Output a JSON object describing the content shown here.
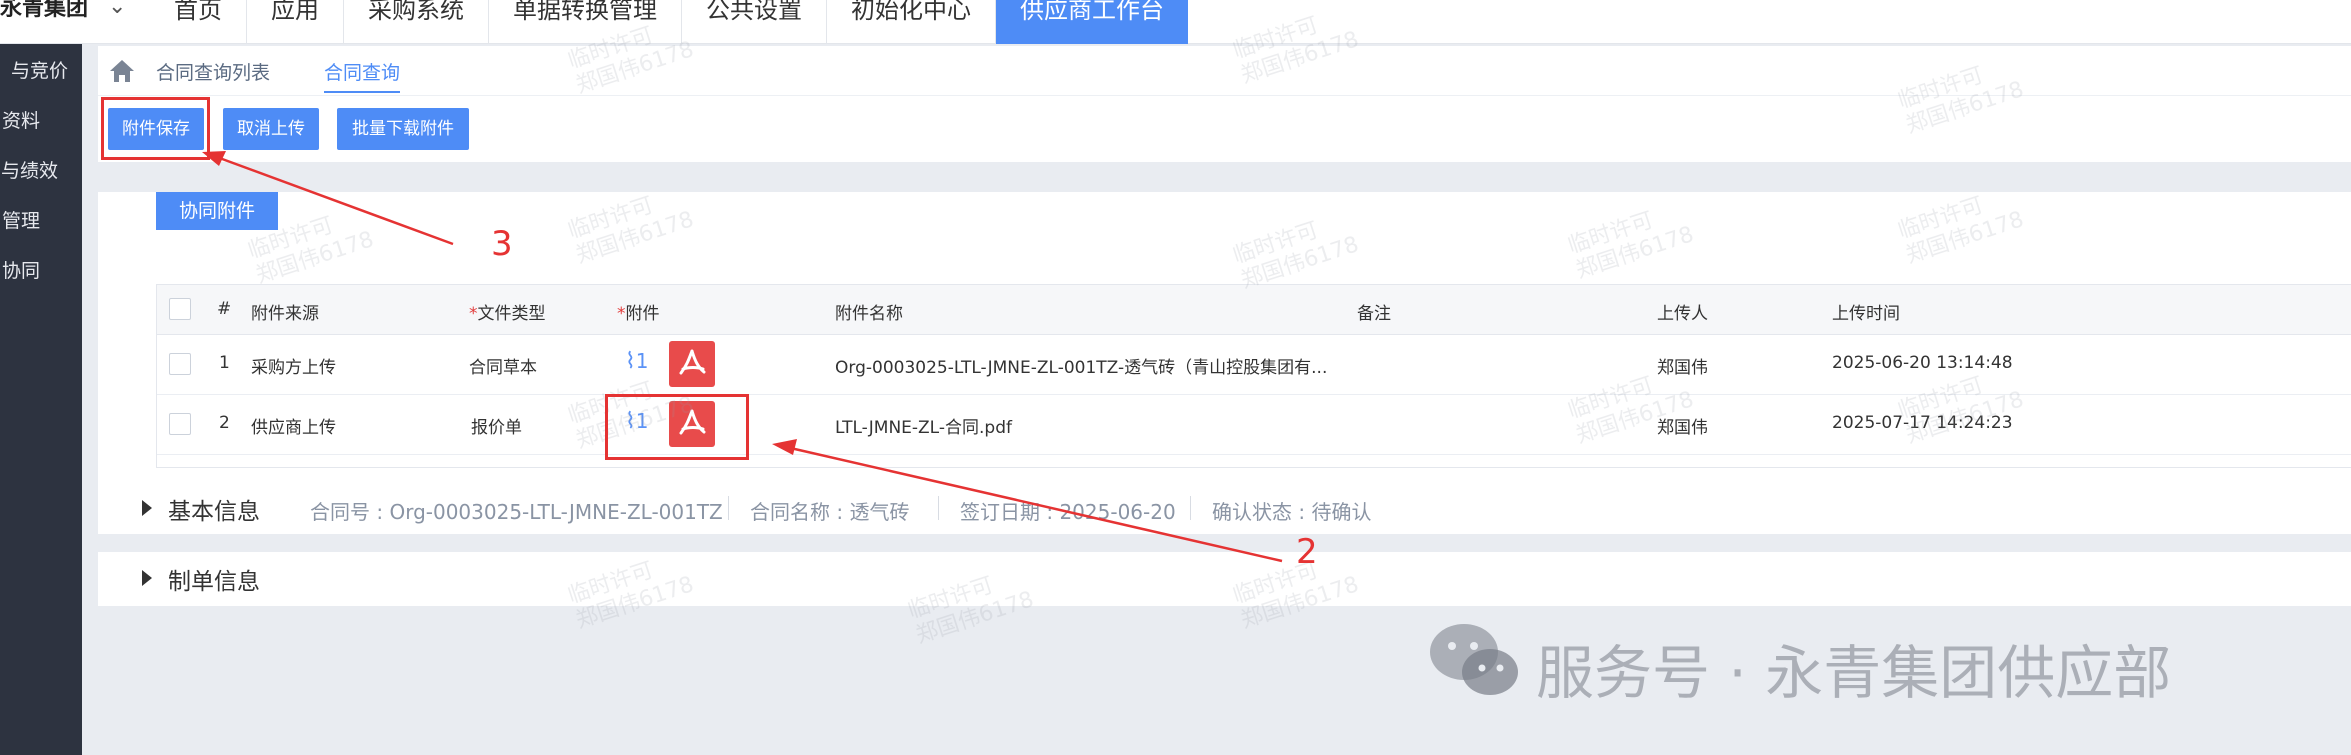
{
  "app": {
    "logo_text": "永青集团"
  },
  "nav": {
    "items": [
      {
        "label": "首页"
      },
      {
        "label": "应用"
      },
      {
        "label": "采购系统"
      },
      {
        "label": "单据转换管理"
      },
      {
        "label": "公共设置"
      },
      {
        "label": "初始化中心"
      },
      {
        "label": "供应商工作台"
      }
    ]
  },
  "sidebar": {
    "items": [
      {
        "label": "与竞价"
      },
      {
        "label": "资料"
      },
      {
        "label": "与绩效"
      },
      {
        "label": "管理"
      },
      {
        "label": "协同"
      }
    ]
  },
  "breadcrumb": {
    "items": [
      {
        "label": "合同查询列表"
      },
      {
        "label": "合同查询"
      }
    ]
  },
  "toolbar": {
    "save_label": "附件保存",
    "cancel_label": "取消上传",
    "download_label": "批量下载附件"
  },
  "section": {
    "label": "协同附件"
  },
  "table": {
    "headers": {
      "index": "#",
      "source": "附件来源",
      "required_mark": "*",
      "file_type": "文件类型",
      "attachment": "附件",
      "name": "附件名称",
      "remark": "备注",
      "uploader": "上传人",
      "upload_time": "上传时间"
    },
    "rows": [
      {
        "index": "1",
        "source": "采购方上传",
        "file_type": "合同草本",
        "count": "1",
        "name": "Org-0003025-LTL-JMNE-ZL-001TZ-透气砖（青山控股集团有...",
        "remark": "",
        "uploader": "郑国伟",
        "upload_time": "2025-06-20 13:14:48"
      },
      {
        "index": "2",
        "source": "供应商上传",
        "file_type": "报价单",
        "count": "1",
        "name": "LTL-JMNE-ZL-合同.pdf",
        "remark": "",
        "uploader": "郑国伟",
        "upload_time": "2025-07-17 14:24:23"
      }
    ]
  },
  "basic_info": {
    "title": "基本信息",
    "contract_no": "合同号 : Org-0003025-LTL-JMNE-ZL-001TZ",
    "contract_name": "合同名称 : 透气砖",
    "sign_date": "签订日期 : 2025-06-20",
    "confirm_status": "确认状态 : 待确认"
  },
  "maker_info": {
    "title": "制单信息"
  },
  "annotations": {
    "label_2": "2",
    "label_3": "3"
  },
  "watermark": {
    "text": "临时许可\n郑国伟6178"
  },
  "footer": {
    "text": "服务号 · 永青集团供应部"
  },
  "colors": {
    "primary": "#4e8cf6",
    "sidebar": "#2d3340",
    "pdf": "#e84b4b",
    "annotation": "#e53333"
  }
}
